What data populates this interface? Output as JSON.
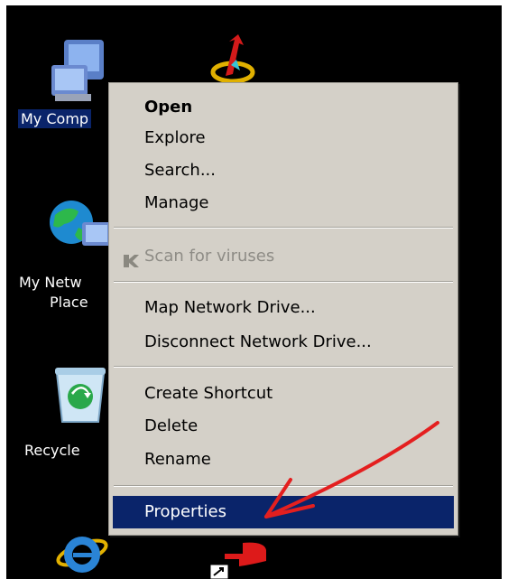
{
  "desktop": {
    "icons": [
      {
        "label": "My Comp",
        "icon": "my-computer-icon"
      },
      {
        "label": "My Netw",
        "label2": "Place",
        "icon": "network-places-icon"
      },
      {
        "label": "Recycle",
        "icon": "recycle-bin-icon"
      },
      {
        "label": "",
        "icon": "internet-explorer-icon"
      }
    ],
    "background_color": "#000000"
  },
  "context_menu": {
    "items": [
      {
        "label": "Open",
        "default": true
      },
      {
        "label": "Explore"
      },
      {
        "label": "Search..."
      },
      {
        "label": "Manage"
      },
      {
        "label": "Scan for viruses",
        "disabled": true,
        "icon": "antivirus-icon"
      },
      {
        "label": "Map Network Drive..."
      },
      {
        "label": "Disconnect Network Drive..."
      },
      {
        "label": "Create Shortcut"
      },
      {
        "label": "Delete"
      },
      {
        "label": "Rename"
      },
      {
        "label": "Properties",
        "selected": true
      }
    ],
    "selection_color": "#0a246a",
    "menu_color": "#d4d0c8"
  },
  "annotation": {
    "arrow_color": "#e41f1f"
  }
}
